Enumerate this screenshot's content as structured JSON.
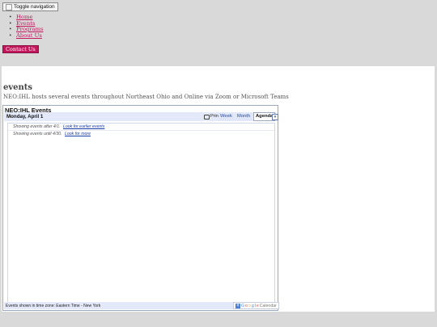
{
  "header": {
    "toggle_label": "Toggle navigation",
    "nav": [
      "Home",
      "Events",
      "Programs",
      "About Us"
    ],
    "contact_label": "Contact Us"
  },
  "main": {
    "title": "events",
    "intro": "NEO:IHL hosts several events throughout Northeast Ohio and Online via Zoom or Microsoft Teams"
  },
  "calendar": {
    "title": "NEO:IHL Events",
    "date": "Monday, April 1",
    "print_label": "Print",
    "tabs": [
      "Week",
      "Month",
      "Agenda"
    ],
    "active_tab": "Agenda",
    "rows": [
      {
        "text": "Showing events after 4/1.",
        "link": "Look for earlier events"
      },
      {
        "text": "Showing events until 4/30.",
        "link": "Look for more"
      }
    ],
    "timezone": "Events shown in time zone: Eastern Time - New York",
    "google_brand": [
      "G",
      "o",
      "o",
      "g",
      "l",
      "e"
    ],
    "calendar_word": "Calendar"
  },
  "colors": {
    "accent": "#c2185b",
    "background": "#d9d9d9",
    "calendar_bar": "#e3e9f8",
    "link": "#1a3fa8"
  },
  "icons": [
    "broken-image-icon",
    "printer-icon",
    "dropdown-arrow-icon",
    "plus-icon"
  ]
}
